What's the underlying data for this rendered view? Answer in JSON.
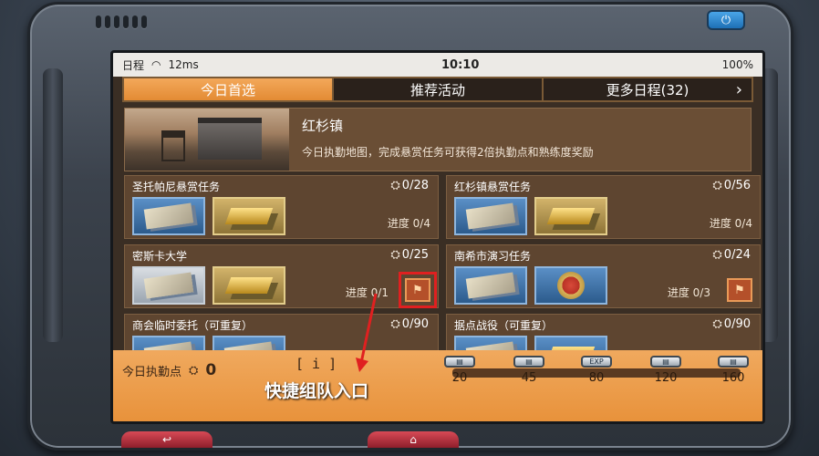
{
  "status": {
    "calendar": "日程",
    "ping": "12ms",
    "time": "10:10",
    "battery": "100%"
  },
  "tabs": [
    {
      "label": "今日首选",
      "active": true
    },
    {
      "label": "推荐活动",
      "active": false
    },
    {
      "label": "更多日程(32)",
      "active": false
    }
  ],
  "banner": {
    "title": "红杉镇",
    "desc": "今日执勤地图，完成悬赏任务可获得2倍执勤点和熟练度奖励"
  },
  "cards": [
    {
      "title": "圣托帕尼悬赏任务",
      "count": "0/28",
      "progress": "进度 0/4",
      "rewards": [
        "blue",
        "gold"
      ],
      "team": false
    },
    {
      "title": "红杉镇悬赏任务",
      "count": "0/56",
      "progress": "进度 0/4",
      "rewards": [
        "blue",
        "gold"
      ],
      "team": false
    },
    {
      "title": "密斯卡大学",
      "count": "0/25",
      "progress": "进度 0/1",
      "rewards": [
        "white",
        "gold"
      ],
      "team": true
    },
    {
      "title": "南希市演习任务",
      "count": "0/24",
      "progress": "进度 0/3",
      "rewards": [
        "blue",
        "blue"
      ],
      "team": true
    },
    {
      "title": "商会临时委托（可重复）",
      "count": "0/90",
      "progress": "",
      "rewards": [
        "blue",
        "blue"
      ],
      "team": false
    },
    {
      "title": "据点战役（可重复）",
      "count": "0/90",
      "progress": "",
      "rewards": [
        "blue",
        "blue"
      ],
      "team": true
    }
  ],
  "footer": {
    "points_label": "今日执勤点",
    "points_value": "0",
    "info": "[ i ]",
    "milestones": [
      "20",
      "45",
      "80",
      "120",
      "160"
    ],
    "chest_exp_label": "EXP"
  },
  "annotation": {
    "text": "快捷组队入口"
  },
  "colors": {
    "accent": "#e8923b",
    "highlight": "#e02020"
  },
  "icons": {
    "back": "back-arrow-icon",
    "home": "home-icon",
    "power": "power-icon"
  }
}
